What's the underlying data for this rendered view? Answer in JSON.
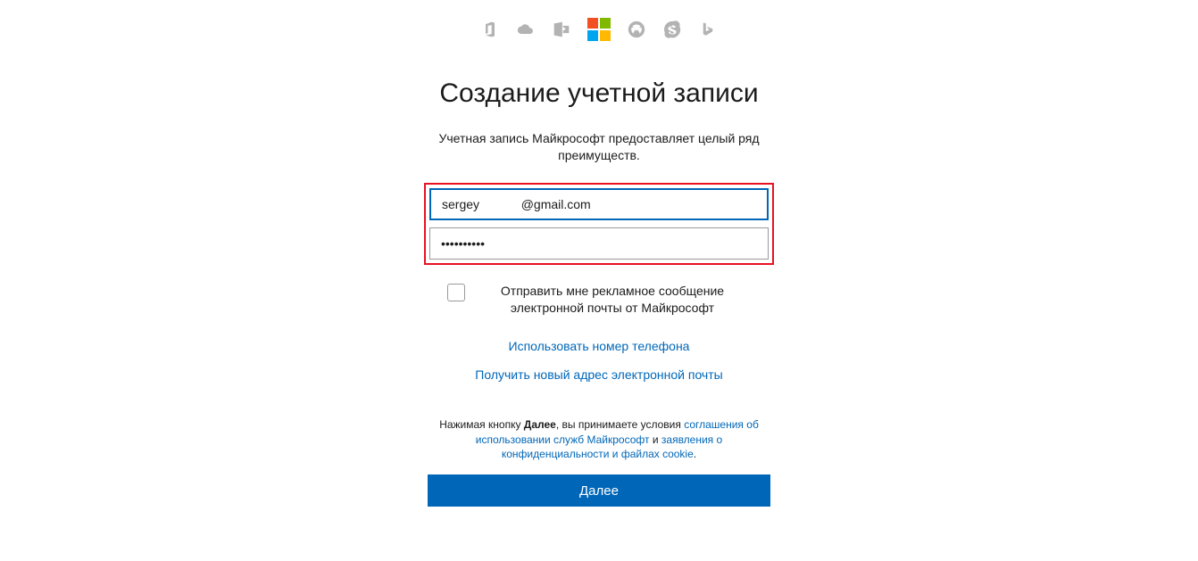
{
  "icons": {
    "office": "office-icon",
    "onedrive": "onedrive-icon",
    "outlook": "outlook-icon",
    "microsoft": "microsoft-logo",
    "xbox": "xbox-icon",
    "skype": "skype-icon",
    "bing": "bing-icon"
  },
  "heading": "Создание учетной записи",
  "subheading": "Учетная запись Майкрософт предоставляет целый ряд преимуществ.",
  "form": {
    "email_value": "sergey            @gmail.com",
    "password_value": "••••••••••"
  },
  "checkbox": {
    "label": "Отправить мне рекламное сообщение электронной почты от Майкрософт"
  },
  "links": {
    "use_phone": "Использовать номер телефона",
    "get_email": "Получить новый адрес электронной почты"
  },
  "terms": {
    "prefix": "Нажимая кнопку ",
    "bold": "Далее",
    "mid1": ", вы принимаете условия ",
    "link1": "соглашения об использовании служб Майкрософт",
    "mid2": " и ",
    "link2": "заявления о конфиденциальности и файлах cookie",
    "suffix": "."
  },
  "button": {
    "next": "Далее"
  }
}
